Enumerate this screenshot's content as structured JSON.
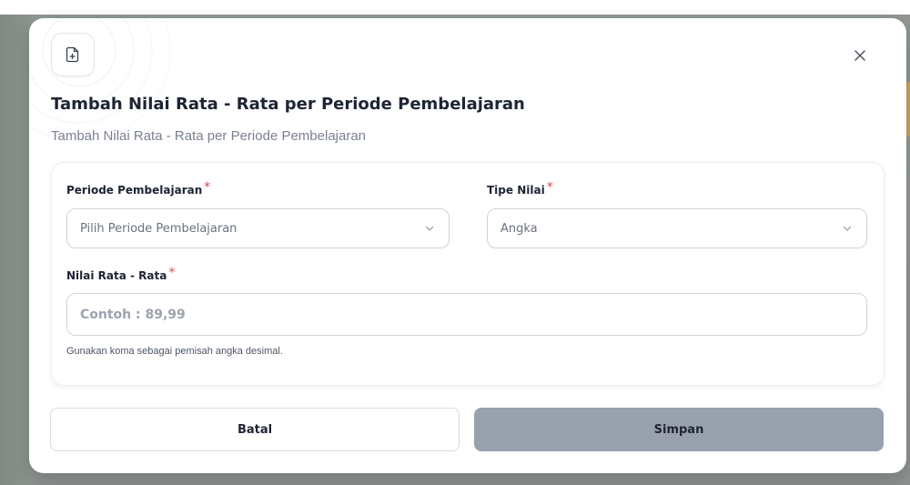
{
  "modal": {
    "title": "Tambah Nilai Rata - Rata per Periode Pembelajaran",
    "subtitle": "Tambah Nilai Rata - Rata per Periode Pembelajaran",
    "header_icon": "file-plus-icon",
    "close_icon": "close-icon"
  },
  "form": {
    "periode": {
      "label": "Periode Pembelajaran",
      "required_mark": "*",
      "selected": "Pilih Periode Pembelajaran"
    },
    "tipe_nilai": {
      "label": "Tipe Nilai",
      "required_mark": "*",
      "selected": "Angka"
    },
    "nilai": {
      "label": "Nilai Rata - Rata",
      "required_mark": "*",
      "placeholder": "Contoh : 89,99",
      "value": "",
      "hint": "Gunakan koma sebagai pemisah angka desimal."
    }
  },
  "actions": {
    "cancel_label": "Batal",
    "save_label": "Simpan"
  },
  "colors": {
    "required": "#e5484d",
    "save_button_bg": "#99a1ae",
    "title": "#1d2433"
  }
}
